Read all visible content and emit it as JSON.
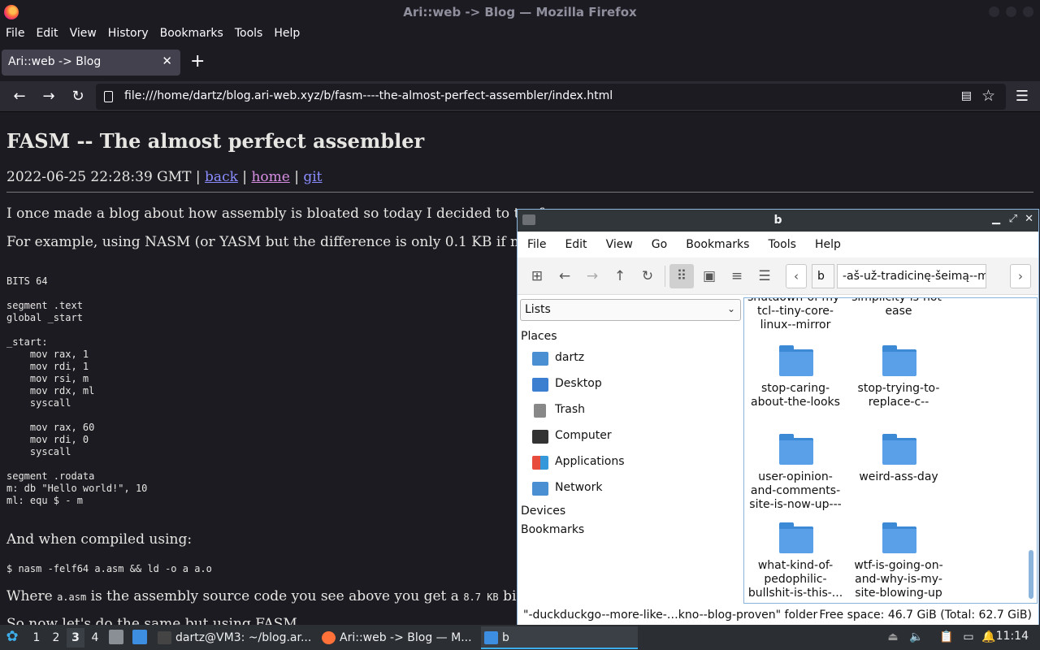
{
  "firefox": {
    "window_title": "Ari::web -> Blog — Mozilla Firefox",
    "menu": [
      "File",
      "Edit",
      "View",
      "History",
      "Bookmarks",
      "Tools",
      "Help"
    ],
    "tab_label": "Ari::web -> Blog",
    "new_tab": "+",
    "url": "file:///home/dartz/blog.ari-web.xyz/b/fasm----the-almost-perfect-assembler/index.html"
  },
  "article": {
    "title": "FASM -- The almost perfect assembler",
    "date": "2022-06-25 22:28:39 GMT",
    "sep": "|",
    "link_back": "back",
    "link_home": "home",
    "link_git": "git",
    "para1": "I once made a blog about how assembly is bloated so today I decided to try fa",
    "para2": "For example, using NASM (or YASM but the difference is only 0.1 KB if not le",
    "code_block": "BITS 64\n\nsegment .text\nglobal _start\n\n_start:\n    mov rax, 1\n    mov rdi, 1\n    mov rsi, m\n    mov rdx, ml\n    syscall\n\n    mov rax, 60\n    mov rdi, 0\n    syscall\n\nsegment .rodata\nm: db \"Hello world!\", 10\nml: equ $ - m",
    "para3": "And when compiled using:",
    "cmd": "$ nasm -felf64 a.asm && ld -o a a.o",
    "para4_a": "Where ",
    "para4_code1": "a.asm",
    "para4_b": " is the assembly source code you see above you get a ",
    "para4_code2": "8.7 KB",
    "para4_c": " binary",
    "para5": "So now let's do the same but using FASM"
  },
  "filemanager": {
    "title": "b",
    "menu": [
      "File",
      "Edit",
      "View",
      "Go",
      "Bookmarks",
      "Tools",
      "Help"
    ],
    "path_segment_b": "b",
    "path_segment_current": "-aš-už-tradicinę-šeimą--mover",
    "side_mode": "Lists",
    "places_heading": "Places",
    "places": [
      {
        "label": "dartz",
        "icon": "home-folder-icon"
      },
      {
        "label": "Desktop",
        "icon": "desktop-icon"
      },
      {
        "label": "Trash",
        "icon": "trash-icon"
      },
      {
        "label": "Computer",
        "icon": "computer-icon"
      },
      {
        "label": "Applications",
        "icon": "applications-icon"
      },
      {
        "label": "Network",
        "icon": "network-icon"
      }
    ],
    "devices_heading": "Devices",
    "bookmarks_heading": "Bookmarks",
    "folders": [
      {
        "label": "shutdown-of-my-tcl--tiny-core-linux--mirror"
      },
      {
        "label": "simplicity-is-not-ease"
      },
      {
        "label": "stop-caring-about-the-looks"
      },
      {
        "label": "stop-trying-to-replace-c--"
      },
      {
        "label": "user-opinion-and-comments-site-is-now-up---"
      },
      {
        "label": "weird-ass-day"
      },
      {
        "label": "what-kind-of-pedophilic-bullshit-is-this-..."
      },
      {
        "label": "wtf-is-going-on-and-why-is-my-site-blowing-up"
      }
    ],
    "status_left": "\"-duckduckgo--more-like-…kno--blog-proven\" folder",
    "status_right": "Free space: 46.7 GiB (Total: 62.7 GiB)"
  },
  "taskbar": {
    "workspaces": [
      "1",
      "2",
      "3",
      "4"
    ],
    "current_workspace": "3",
    "tasks": [
      {
        "label": "dartz@VM3: ~/blog.ar..."
      },
      {
        "label": "Ari::web -> Blog — M..."
      },
      {
        "label": "b"
      }
    ],
    "clock": "11:14"
  },
  "colors": {
    "link": "#8a8cff",
    "visited_link": "#d78ee3",
    "folder_blue": "#5aa0e8",
    "accent": "#3daee9"
  }
}
